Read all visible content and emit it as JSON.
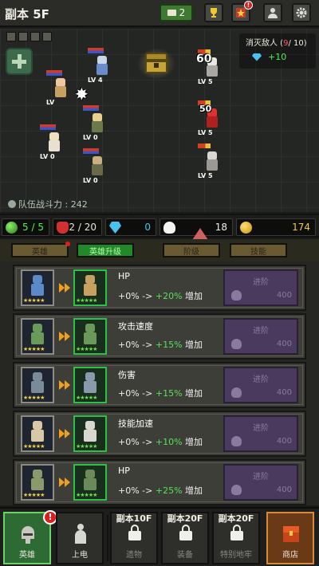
{
  "header": {
    "stage_title": "副本 5F",
    "ticket_count": "2",
    "trophy_icon": "trophy-icon",
    "event_badge": "!",
    "profile_icon": "profile-icon",
    "settings_icon": "gear-icon"
  },
  "battle": {
    "kill_label": "消灭敌人 (",
    "kill_current": "9",
    "kill_total": "/ 10)",
    "reward": "+10",
    "team_power": "队伍战斗力 : 242",
    "allies": [
      {
        "lv": "LV"
      },
      {
        "lv": "LV 4"
      },
      {
        "lv": "LV 0"
      },
      {
        "lv": "LV 0"
      },
      {
        "lv": "LV 0"
      },
      {
        "lv": "LV 0"
      }
    ],
    "enemies": [
      {
        "lv": "LV 5",
        "damage": "60"
      },
      {
        "lv": "LV 5",
        "damage": "50"
      },
      {
        "lv": "LV 5",
        "damage": ""
      },
      {
        "lv": "LV 5",
        "damage": ""
      }
    ]
  },
  "resources": {
    "energy": "5 / 5",
    "potions": "2 / 20",
    "gems": "0",
    "souls": "18",
    "gold": "174"
  },
  "tabs": [
    {
      "label": "英雄",
      "active": false
    },
    {
      "label": "英雄升级",
      "active": true
    },
    {
      "label": "阶级",
      "active": false
    },
    {
      "label": "技能",
      "active": false
    }
  ],
  "upgrades": [
    {
      "stat": "HP",
      "from": "+0%",
      "to": "+20%",
      "suffix": "增加",
      "button": "进阶",
      "cost": "400",
      "from_color": "#5a8ac8",
      "to_color": "#c8a060"
    },
    {
      "stat": "攻击速度",
      "from": "+0%",
      "to": "+15%",
      "suffix": "增加",
      "button": "进阶",
      "cost": "400",
      "from_color": "#6a9a5a",
      "to_color": "#6a9a5a"
    },
    {
      "stat": "伤害",
      "from": "+0%",
      "to": "+15%",
      "suffix": "增加",
      "button": "进阶",
      "cost": "400",
      "from_color": "#7a8a9a",
      "to_color": "#8a9aaa"
    },
    {
      "stat": "技能加速",
      "from": "+0%",
      "to": "+10%",
      "suffix": "增加",
      "button": "进阶",
      "cost": "400",
      "from_color": "#d8c8a8",
      "to_color": "#d8d8d0"
    },
    {
      "stat": "HP",
      "from": "+0%",
      "to": "+25%",
      "suffix": "增加",
      "button": "进阶",
      "cost": "400",
      "from_color": "#8a9a6a",
      "to_color": "#6a8a5a"
    }
  ],
  "nav": {
    "hero": "英雄",
    "hero_alert": "!",
    "summon": "上电",
    "relic_lock": "副本10F",
    "relic": "遗物",
    "equip_lock": "副本20F",
    "equip": "装备",
    "dungeon_lock": "副本20F",
    "dungeon": "特别地牢",
    "shop": "商店"
  }
}
